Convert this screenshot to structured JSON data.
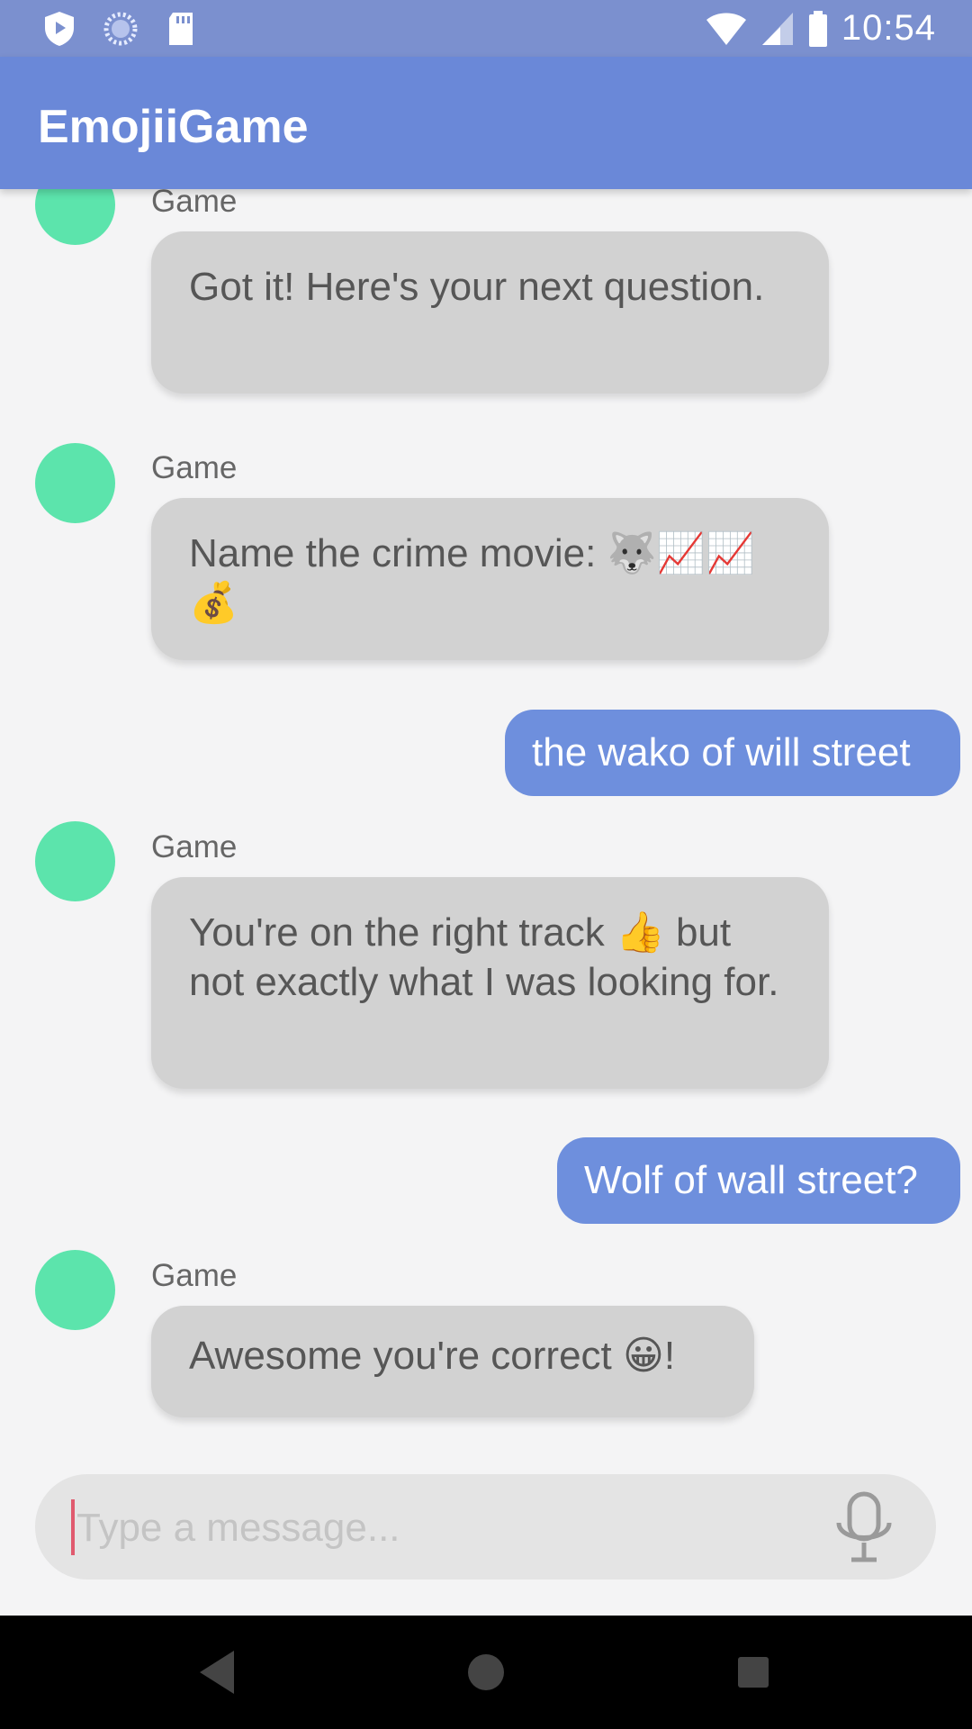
{
  "status_bar": {
    "time": "10:54",
    "left_icons": [
      "shield-play-icon",
      "loading-circle-icon",
      "sd-card-icon"
    ],
    "right_icons": [
      "wifi-icon",
      "cell-signal-icon",
      "battery-icon"
    ]
  },
  "app_bar": {
    "title": "EmojiiGame"
  },
  "messages": [
    {
      "from": "Game",
      "text": "Got it! Here's your next question."
    },
    {
      "from": "Game",
      "text": "Name the crime movie: 🐺📈📈💰"
    },
    {
      "from": "user",
      "text": "the wako of will street"
    },
    {
      "from": "Game",
      "text": "You're on the right track 👍 but not exactly what I was looking for."
    },
    {
      "from": "user",
      "text": "Wolf of wall street?"
    },
    {
      "from": "Game",
      "text": "Awesome you're correct 😀!"
    }
  ],
  "composer": {
    "placeholder": "Type a message...",
    "value": ""
  },
  "nav_bar": {
    "icons": [
      "back-icon",
      "home-icon",
      "recents-icon"
    ]
  },
  "colors": {
    "status_bar": "#7b90cf",
    "app_bar": "#6a88d8",
    "avatar": "#5ce4ac",
    "incoming_bubble": "#d2d2d2",
    "outgoing_bubble": "#6e8fdd"
  }
}
